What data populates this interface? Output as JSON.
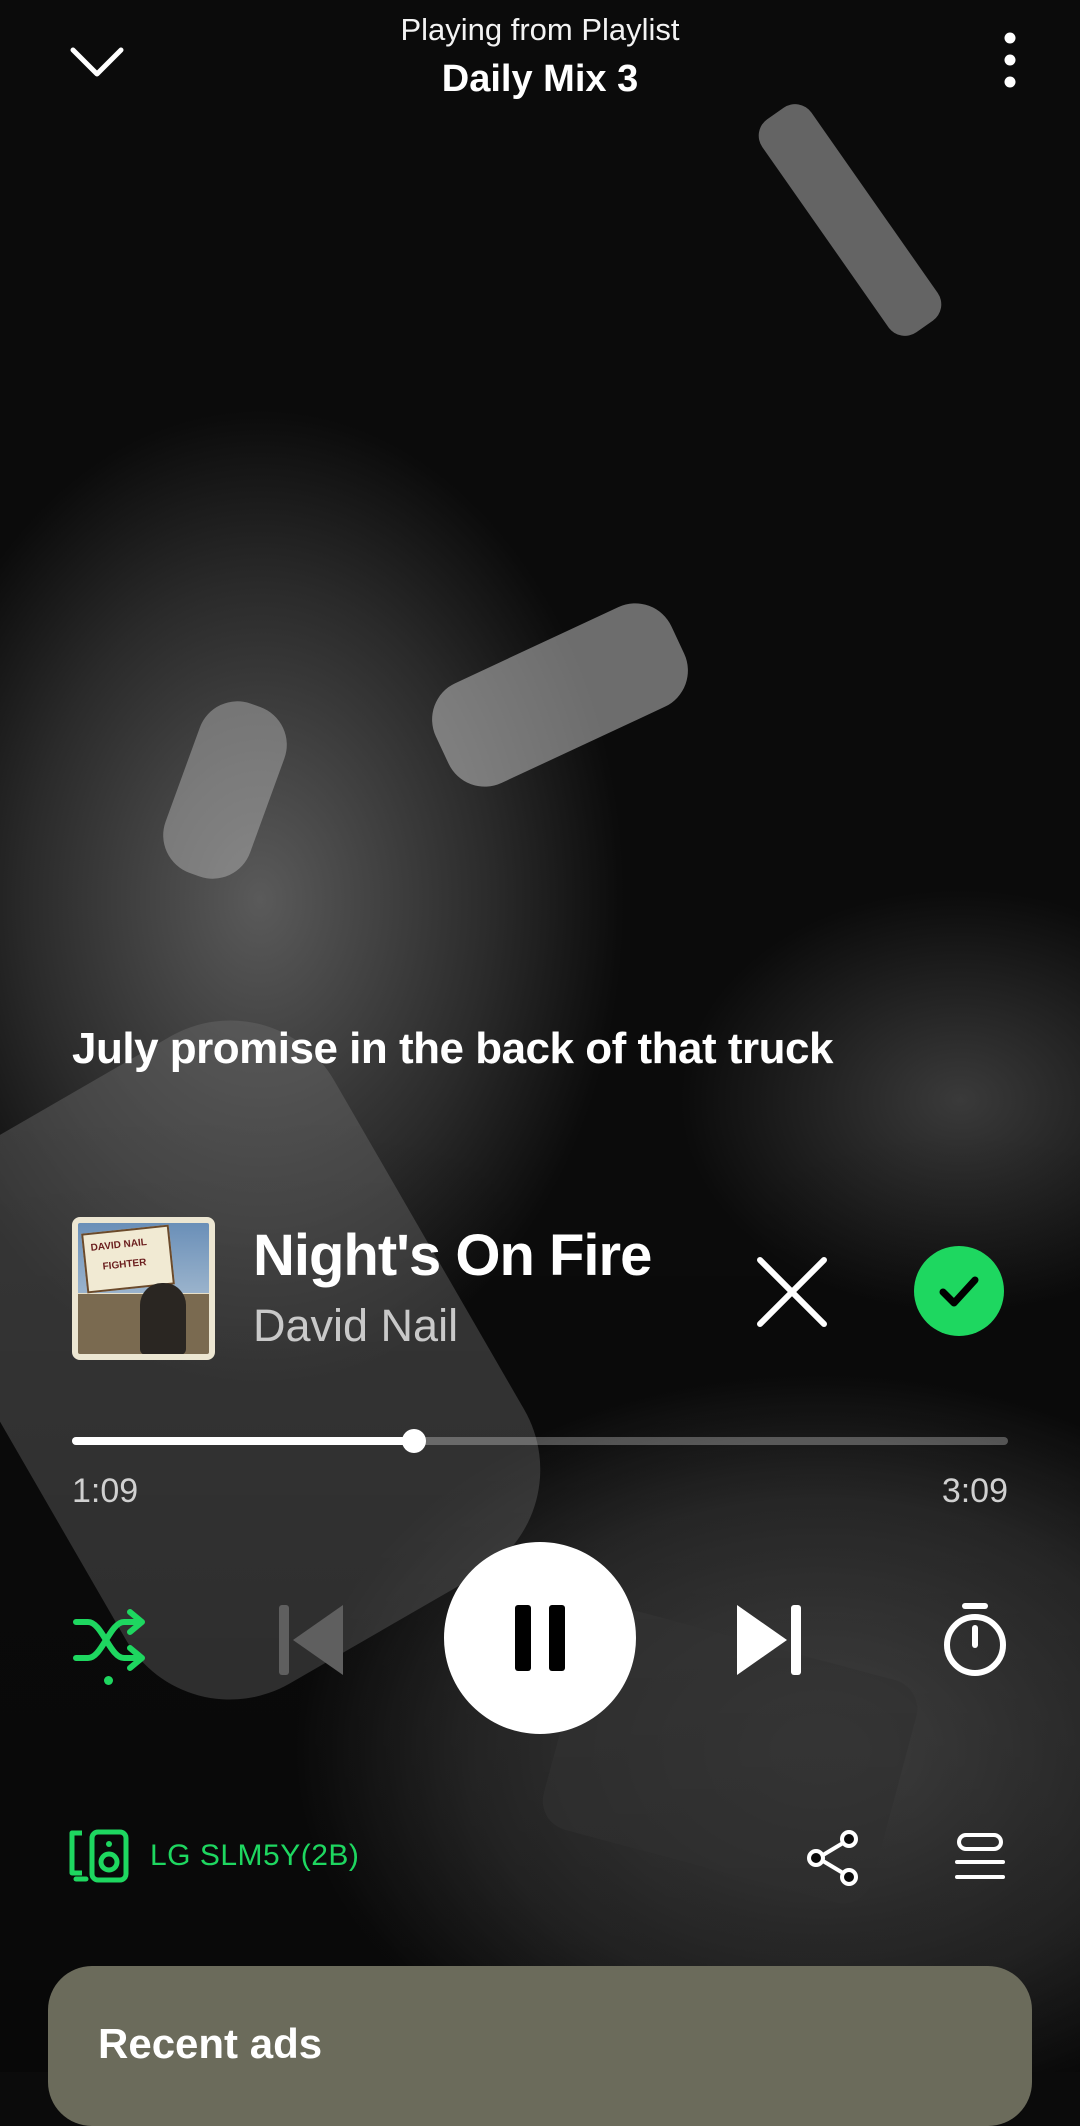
{
  "header": {
    "context_label": "Playing from Playlist",
    "context_name": "Daily Mix 3",
    "collapse_icon": "chevron-down-icon",
    "more_icon": "more-vertical-icon"
  },
  "lyrics": {
    "current_line": "July promise in the back of that truck"
  },
  "track": {
    "title": "Night's On Fire",
    "artist": "David Nail",
    "cover_text": [
      "DAVID NAIL",
      "FIGHTER"
    ],
    "hide_icon": "close-icon",
    "added_icon": "check-circle-icon"
  },
  "progress": {
    "elapsed": "1:09",
    "total": "3:09",
    "fraction": 0.365
  },
  "controls": {
    "shuffle_icon": "shuffle-icon",
    "shuffle_active": true,
    "prev_icon": "skip-previous-icon",
    "play_state": "playing",
    "play_icon": "pause-icon",
    "next_icon": "skip-next-icon",
    "timer_icon": "sleep-timer-icon"
  },
  "connect": {
    "device_name": "LG SLM5Y(2B)",
    "device_icon": "speaker-devices-icon",
    "share_icon": "share-icon",
    "queue_icon": "queue-icon"
  },
  "ads": {
    "title": "Recent ads"
  },
  "colors": {
    "accent": "#1ed760",
    "panel": "#6b6b5b"
  }
}
